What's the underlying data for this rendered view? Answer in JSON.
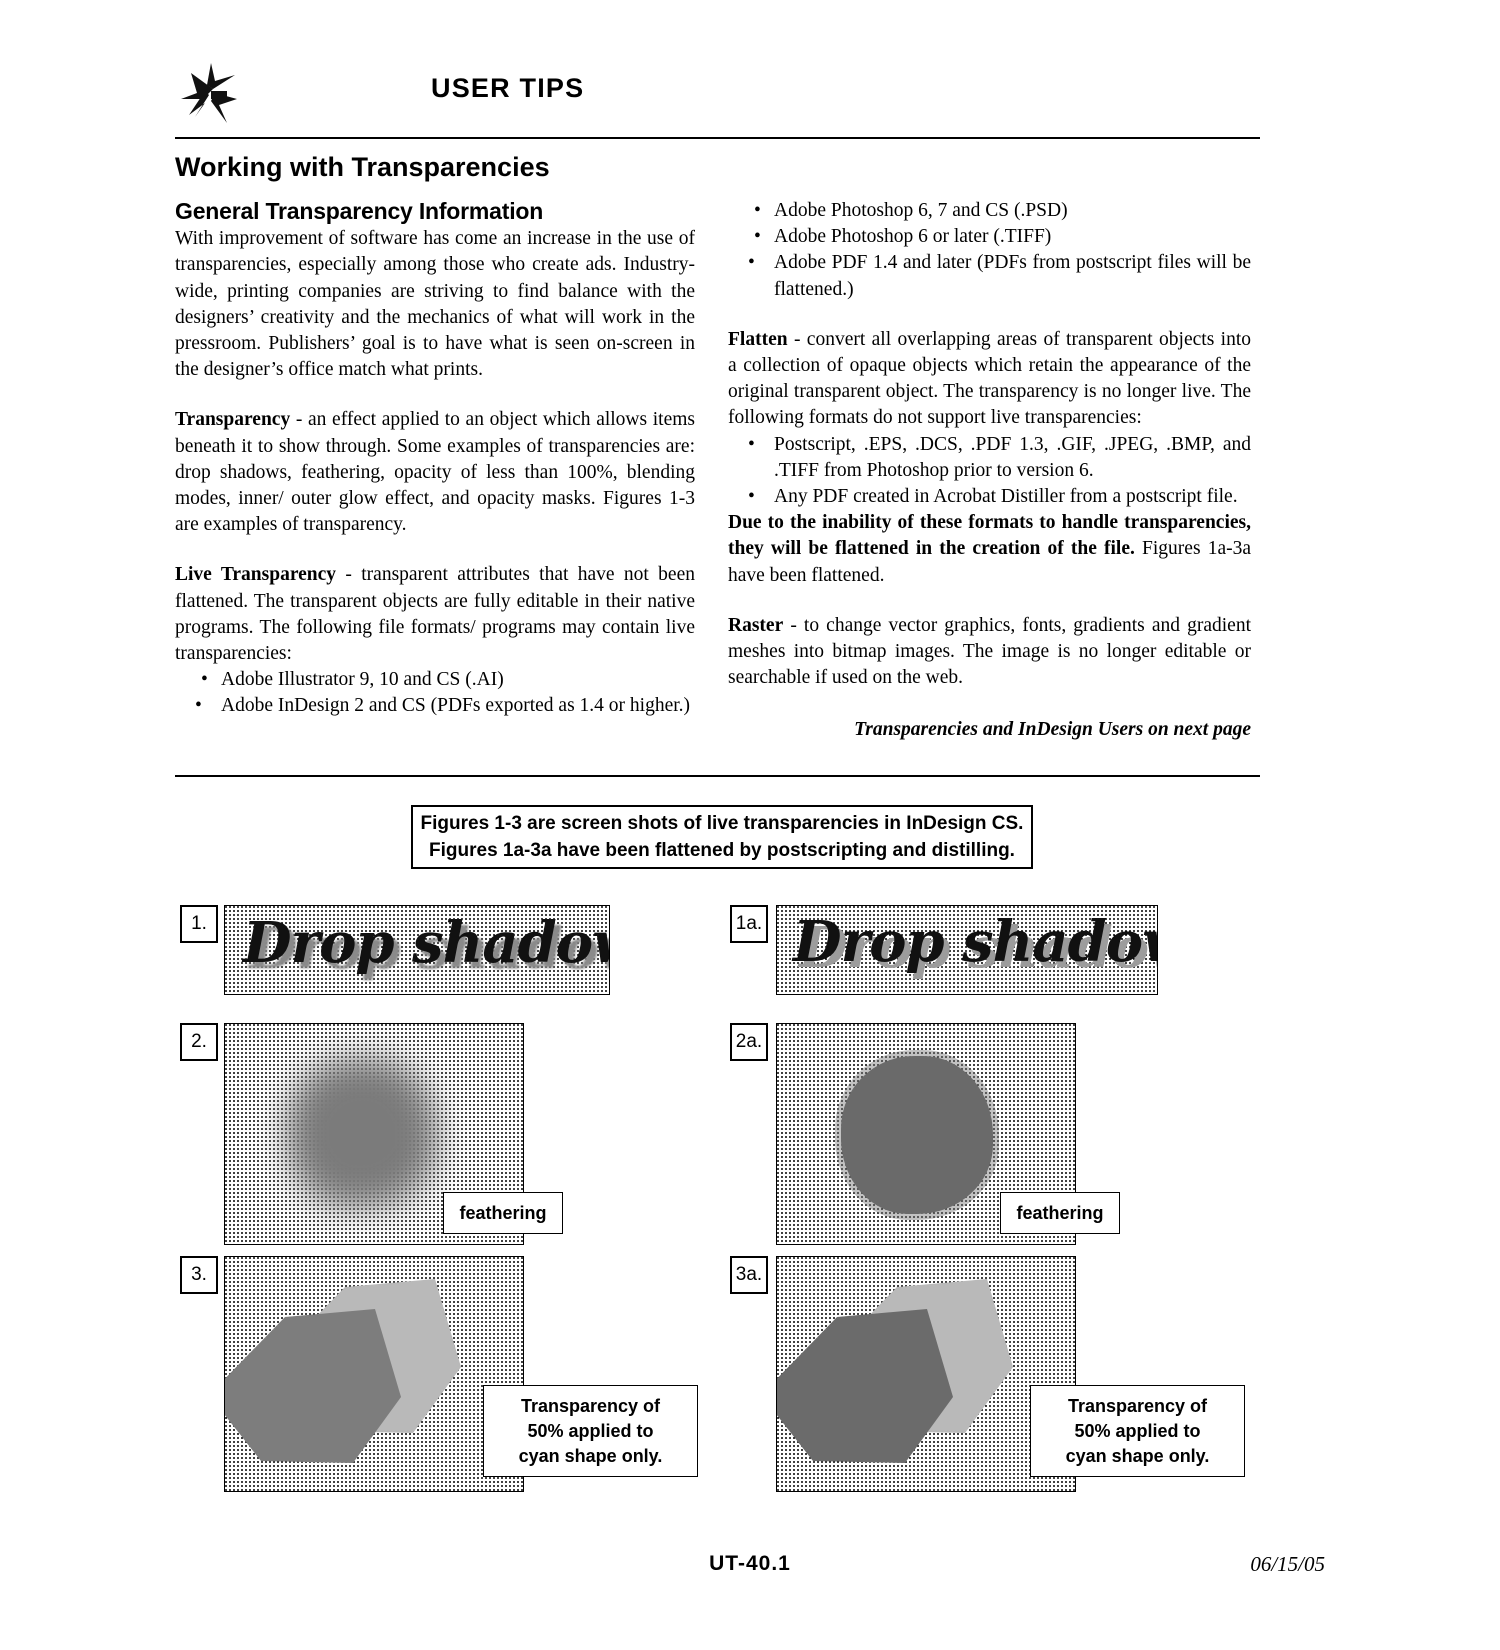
{
  "header": {
    "logo_name": "pinwheel-logo-icon",
    "title": "USER TIPS"
  },
  "page_title": "Working with Transparencies",
  "left_column": {
    "section_heading": "General Transparency Information",
    "intro": "With improvement of software has come an increase in the use of transparencies, especially among those who create ads. Industry-wide, printing companies are striving to find balance with the designers’ creativity and the mechanics of what will work in the pressroom. Publishers’ goal is to have what is seen on-screen in the designer’s office match what prints.",
    "transparency_term": "Transparency",
    "transparency_def": " - an effect applied to an object which allows items beneath it to show through. Some examples of transparencies are: drop shadows, feathering, opacity of less than 100%, blending modes, inner/ outer glow effect, and opacity masks. Figures 1-3 are examples of transparency.",
    "live_term": "Live Transparency",
    "live_def": " - transparent attributes that have not been flattened. The transparent objects are fully editable in their native programs. The following file formats/ programs may contain live transparencies:",
    "bullets": [
      "Adobe Illustrator 9, 10 and CS (.AI)",
      "Adobe InDesign 2 and CS (PDFs exported as 1.4 or higher.)"
    ]
  },
  "right_column": {
    "bullets_top": [
      "Adobe Photoshop 6, 7 and CS (.PSD)",
      "Adobe Photoshop 6 or later (.TIFF)",
      "Adobe PDF 1.4 and later (PDFs from postscript files will be flattened.)"
    ],
    "flatten_term": "Flatten",
    "flatten_def": " - convert all overlapping areas of transparent objects into a collection of opaque objects which retain the appearance of the original transparent object. The transparency is no longer live. The following formats do not support live transparencies:",
    "bullets_mid": [
      "Postscript, .EPS, .DCS, .PDF 1.3, .GIF, .JPEG, .BMP, and .TIFF from Photoshop prior to version 6.",
      "Any PDF created in Acrobat Distiller from a postscript file."
    ],
    "due_bold": "Due to the inability of these formats to handle transparencies, they will be flattened in the creation of the file.",
    "due_rest": " Figures 1a-3a have been flattened.",
    "raster_term": "Raster",
    "raster_def": " - to change vector graphics, fonts, gradients and gradient meshes into bitmap images. The image is no longer editable or searchable if used on the web.",
    "next_page_note": "Transparencies and InDesign Users on next page"
  },
  "caption_box": {
    "line1": "Figures 1-3 are screen shots of live transparencies in InDesign CS.",
    "line2": "Figures 1a-3a have been flattened by postscripting and distilling."
  },
  "figures": [
    {
      "number": "1.",
      "content": "Drop shadow",
      "kind": "drop-shadow-live"
    },
    {
      "number": "1a.",
      "content": "Drop shadow",
      "kind": "drop-shadow-flat"
    },
    {
      "number": "2.",
      "content": "",
      "kind": "feather-live",
      "label": "feathering"
    },
    {
      "number": "2a.",
      "content": "",
      "kind": "feather-flat",
      "label": "feathering"
    },
    {
      "number": "3.",
      "content": "",
      "kind": "overlap-live",
      "label_lines": [
        "Transparency of",
        "50% applied to",
        "cyan shape only."
      ]
    },
    {
      "number": "3a.",
      "content": "",
      "kind": "overlap-flat",
      "label_lines": [
        "Transparency of",
        "50% applied to",
        "cyan shape only."
      ]
    }
  ],
  "footer": {
    "doc_id": "UT-40.1",
    "date": "06/15/05"
  },
  "colors": {
    "ink": "#000000",
    "halftone_fill": "#c9c9c9",
    "shape_gray": "#6f6f6f",
    "shape_dark": "#595959"
  }
}
